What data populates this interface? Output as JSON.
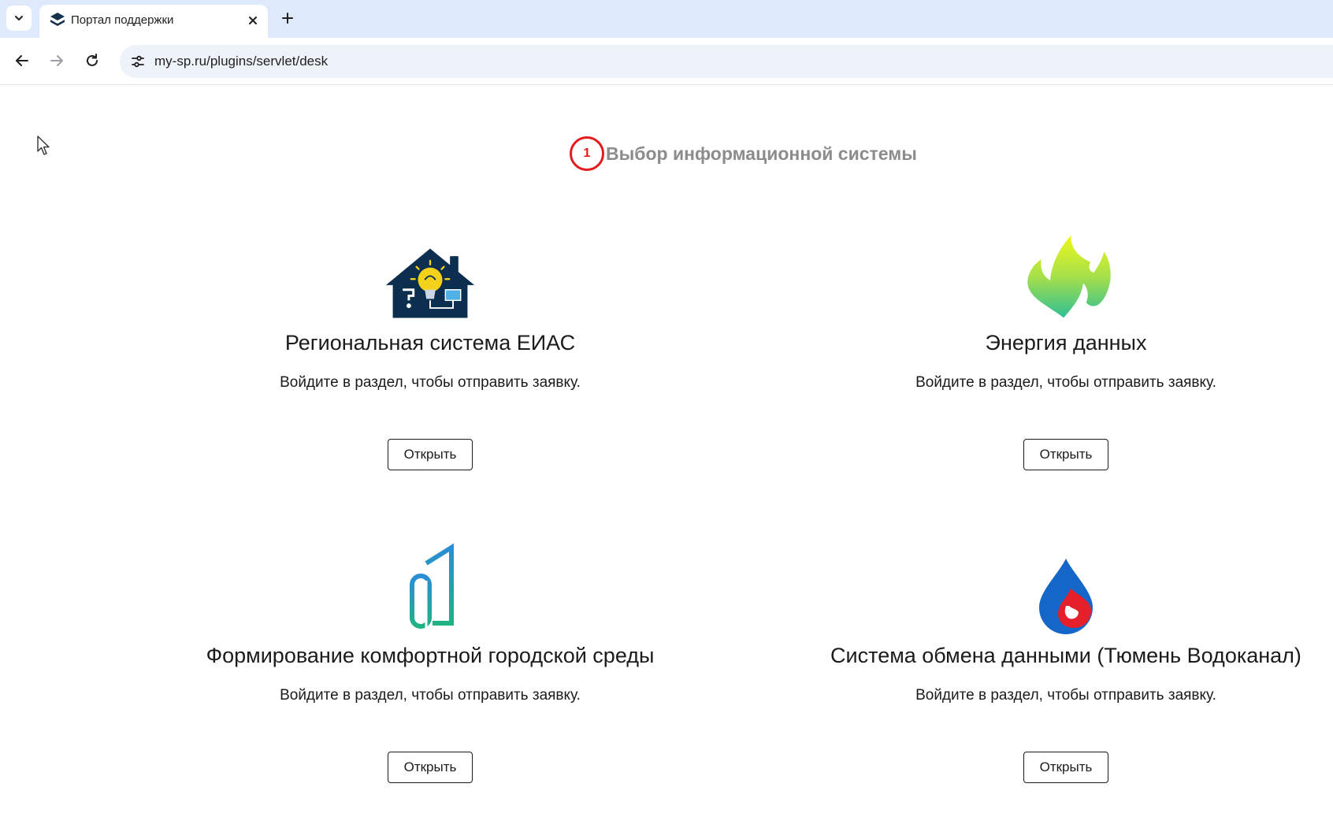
{
  "browser": {
    "tab_title": "Портал поддержки",
    "url": "my-sp.ru/plugins/servlet/desk"
  },
  "page": {
    "step_number": "1",
    "title": "Выбор информационной системы"
  },
  "cards": [
    {
      "title": "Региональная система ЕИАС",
      "description": "Войдите в раздел, чтобы отправить заявку.",
      "button": "Открыть",
      "icon": "house-lightbulb-icon"
    },
    {
      "title": "Энергия данных",
      "description": "Войдите в раздел, чтобы отправить заявку.",
      "button": "Открыть",
      "icon": "flame-icon"
    },
    {
      "title": "Формирование комфортной городской среды",
      "description": "Войдите в раздел, чтобы отправить заявку.",
      "button": "Открыть",
      "icon": "building-logo-icon"
    },
    {
      "title": "Система обмена данными (Тюмень Водоканал)",
      "description": "Войдите в раздел, чтобы отправить заявку.",
      "button": "Открыть",
      "icon": "water-drop-icon"
    }
  ],
  "colors": {
    "step_accent": "#e31b1b",
    "title_gray": "#8c8c8c",
    "tabbar_bg": "#dfe9fc"
  }
}
